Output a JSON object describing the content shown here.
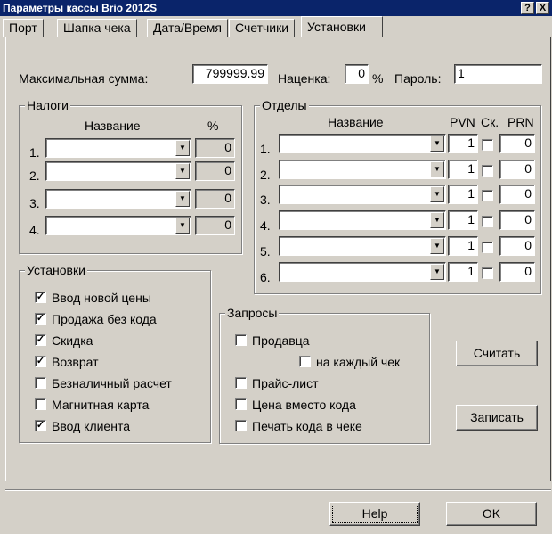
{
  "window": {
    "title": "Параметры кассы Brio 2012S",
    "help_glyph": "?",
    "close_glyph": "X"
  },
  "tabs": [
    "Порт",
    "Шапка чека",
    "Дата/Время",
    "Счетчики",
    "Установки"
  ],
  "top": {
    "max_sum_label": "Максимальная сумма:",
    "max_sum_value": "799999.99",
    "markup_label": "Наценка:",
    "markup_value": "0",
    "markup_unit": "%",
    "password_label": "Пароль:",
    "password_value": "1"
  },
  "taxes": {
    "title": "Налоги",
    "col_name": "Название",
    "col_pct": "%",
    "rows": [
      {
        "num": "1.",
        "pct": "0"
      },
      {
        "num": "2.",
        "pct": "0"
      },
      {
        "num": "3.",
        "pct": "0"
      },
      {
        "num": "4.",
        "pct": "0"
      }
    ]
  },
  "departments": {
    "title": "Отделы",
    "col_name": "Название",
    "col_pvn": "PVN",
    "col_sk": "Ск.",
    "col_prn": "PRN",
    "rows": [
      {
        "num": "1.",
        "pvn": "1",
        "prn": "0"
      },
      {
        "num": "2.",
        "pvn": "1",
        "prn": "0"
      },
      {
        "num": "3.",
        "pvn": "1",
        "prn": "0"
      },
      {
        "num": "4.",
        "pvn": "1",
        "prn": "0"
      },
      {
        "num": "5.",
        "pvn": "1",
        "prn": "0"
      },
      {
        "num": "6.",
        "pvn": "1",
        "prn": "0"
      }
    ]
  },
  "settings": {
    "title": "Установки",
    "items": [
      {
        "label": "Ввод новой цены",
        "mark": "✓"
      },
      {
        "label": "Продажа без кода",
        "mark": "✓"
      },
      {
        "label": "Скидка",
        "mark": "✓"
      },
      {
        "label": "Возврат",
        "mark": "✓"
      },
      {
        "label": "Безналичный расчет",
        "mark": ""
      },
      {
        "label": "Магнитная карта",
        "mark": ""
      },
      {
        "label": "Ввод клиента",
        "mark": "✓"
      }
    ]
  },
  "requests": {
    "title": "Запросы",
    "seller": {
      "label": "Продавца",
      "mark": ""
    },
    "each_check": {
      "label": "на каждый чек",
      "mark": ""
    },
    "price_list": {
      "label": "Прайс-лист",
      "mark": ""
    },
    "price_instead_code": {
      "label": "Цена вместо кода",
      "mark": ""
    },
    "print_code": {
      "label": "Печать кода в чеке",
      "mark": ""
    }
  },
  "buttons": {
    "read": "Считать",
    "write": "Записать",
    "help": "Help",
    "ok": "OK"
  },
  "icons": {
    "dropdown_arrow": "▼"
  }
}
